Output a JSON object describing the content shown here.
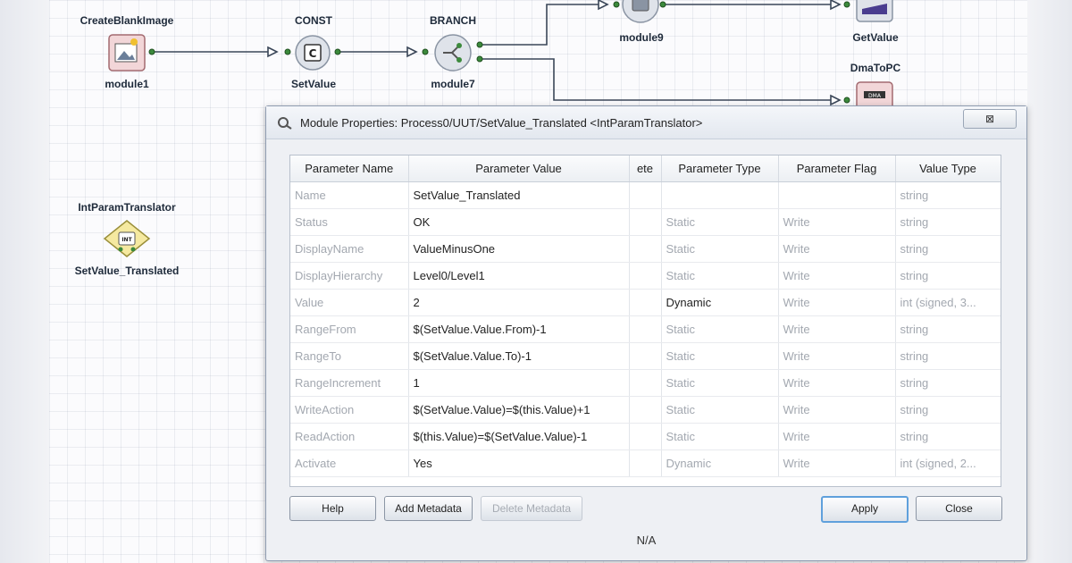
{
  "canvas": {
    "modules": [
      {
        "id": "create_blank",
        "top": "CreateBlankImage",
        "bottom": "module1"
      },
      {
        "id": "const",
        "top": "CONST",
        "bottom": "SetValue"
      },
      {
        "id": "branch",
        "top": "BRANCH",
        "bottom": "module7"
      },
      {
        "id": "module9",
        "top": "",
        "bottom": "module9"
      },
      {
        "id": "getvalue",
        "top": "",
        "bottom": "GetValue"
      },
      {
        "id": "dmatopc",
        "top": "DmaToPC",
        "bottom": ""
      },
      {
        "id": "translator",
        "top": "IntParamTranslator",
        "bottom": "SetValue_Translated"
      }
    ]
  },
  "dialog": {
    "title": "Module Properties: Process0/UUT/SetValue_Translated <IntParamTranslator>",
    "close_label": "⊠",
    "columns": [
      "Parameter Name",
      "Parameter Value",
      "ete",
      "Parameter Type",
      "Parameter Flag",
      "Value Type"
    ],
    "rows": [
      [
        "Name",
        "SetValue_Translated",
        "",
        "",
        "",
        "string"
      ],
      [
        "Status",
        "OK",
        "",
        "Static",
        "Write",
        "string"
      ],
      [
        "DisplayName",
        "ValueMinusOne",
        "",
        "Static",
        "Write",
        "string"
      ],
      [
        "DisplayHierarchy",
        "Level0/Level1",
        "",
        "Static",
        "Write",
        "string"
      ],
      [
        "Value",
        "2",
        "",
        "Dynamic",
        "Write",
        "int (signed, 3..."
      ],
      [
        "RangeFrom",
        "$(SetValue.Value.From)-1",
        "",
        "Static",
        "Write",
        "string"
      ],
      [
        "RangeTo",
        "$(SetValue.Value.To)-1",
        "",
        "Static",
        "Write",
        "string"
      ],
      [
        "RangeIncrement",
        "1",
        "",
        "Static",
        "Write",
        "string"
      ],
      [
        "WriteAction",
        "$(SetValue.Value)=$(this.Value)+1",
        "",
        "Static",
        "Write",
        "string"
      ],
      [
        "ReadAction",
        "$(this.Value)=$(SetValue.Value)-1",
        "",
        "Static",
        "Write",
        "string"
      ],
      [
        "Activate",
        "Yes",
        "",
        "Dynamic",
        "Write",
        "int (signed, 2..."
      ]
    ],
    "buttons": {
      "help": "Help",
      "add_metadata": "Add Metadata",
      "delete_metadata": "Delete Metadata",
      "apply": "Apply",
      "close": "Close"
    },
    "status": "N/A"
  },
  "colors": {
    "accent": "#5fa0dc",
    "wire": "#3a4658",
    "port": "#3c8a3c"
  }
}
